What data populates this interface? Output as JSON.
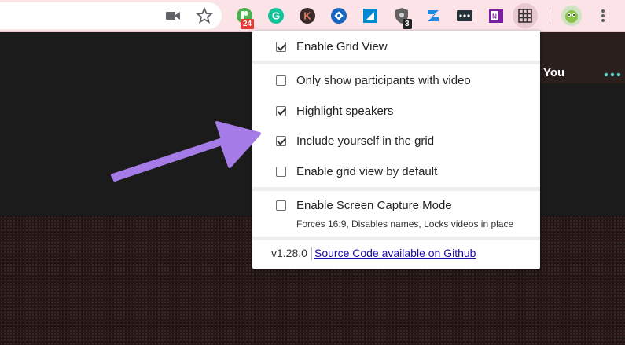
{
  "toolbar": {
    "icons": [
      "camera-icon",
      "star-icon",
      "pushbullet-icon",
      "grammarly-icon",
      "k-extension-icon",
      "puzzle-extension-icon",
      "notes-extension-icon",
      "shield-extension-icon",
      "zoho-extension-icon",
      "dots-extension-icon",
      "onenote-icon",
      "grid-view-extension-icon",
      "avatar",
      "more-menu-icon"
    ],
    "badge_1": "24",
    "badge_2": "3"
  },
  "meeting": {
    "you_label": "You"
  },
  "popup": {
    "enable_grid_view": {
      "label": "Enable Grid View",
      "checked": true
    },
    "only_video": {
      "label": "Only show participants with video",
      "checked": false
    },
    "highlight_speakers": {
      "label": "Highlight speakers",
      "checked": true
    },
    "include_yourself": {
      "label": "Include yourself in the grid",
      "checked": true
    },
    "grid_default": {
      "label": "Enable grid view by default",
      "checked": false
    },
    "screen_capture": {
      "label": "Enable Screen Capture Mode",
      "checked": false,
      "note": "Forces 16:9, Disables names, Locks videos in place"
    },
    "version": "v1.28.0",
    "source_link": "Source Code available on Github"
  },
  "colors": {
    "toolbar_bg": "#fbe3e8",
    "arrow": "#a57be8",
    "link": "#1a0dab"
  }
}
